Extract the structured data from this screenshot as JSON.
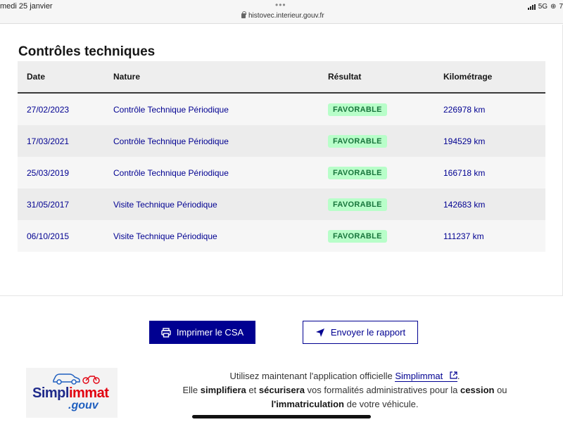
{
  "status_bar": {
    "time": "medi 25 janvier",
    "dots": "•••",
    "url": "histovec.interieur.gouv.fr",
    "network": "5G",
    "battery": "7"
  },
  "section": {
    "title": "Contrôles techniques"
  },
  "table": {
    "headers": [
      "Date",
      "Nature",
      "Résultat",
      "Kilométrage"
    ],
    "rows": [
      {
        "date": "27/02/2023",
        "nature": "Contrôle Technique Périodique",
        "result": "FAVORABLE",
        "km": "226978 km"
      },
      {
        "date": "17/03/2021",
        "nature": "Contrôle Technique Périodique",
        "result": "FAVORABLE",
        "km": "194529 km"
      },
      {
        "date": "25/03/2019",
        "nature": "Contrôle Technique Périodique",
        "result": "FAVORABLE",
        "km": "166718 km"
      },
      {
        "date": "31/05/2017",
        "nature": "Visite Technique Périodique",
        "result": "FAVORABLE",
        "km": "142683 km"
      },
      {
        "date": "06/10/2015",
        "nature": "Visite Technique Périodique",
        "result": "FAVORABLE",
        "km": "111237 km"
      }
    ]
  },
  "actions": {
    "print_label": "Imprimer le CSA",
    "print_icon": "printer-icon",
    "send_label": "Envoyer le rapport",
    "send_icon": "send-icon"
  },
  "promo": {
    "logo_text_1": "Simpl",
    "logo_text_2": "immat",
    "logo_gouv": ".gouv",
    "line1_prefix": "Utilisez maintenant l'application officielle ",
    "line1_link": "Simplimmat",
    "line1_suffix": ".",
    "line2_a": "Elle ",
    "line2_b": "simplifiera",
    "line2_c": " et ",
    "line2_d": "sécurisera",
    "line2_e": " vos formalités administratives pour la ",
    "line2_f": "cession",
    "line2_g": " ou",
    "line3_a": "l'immatriculation",
    "line3_b": " de votre véhicule."
  },
  "colors": {
    "primary": "#000091",
    "badge_bg": "#b8fec9",
    "badge_text": "#18753c"
  }
}
